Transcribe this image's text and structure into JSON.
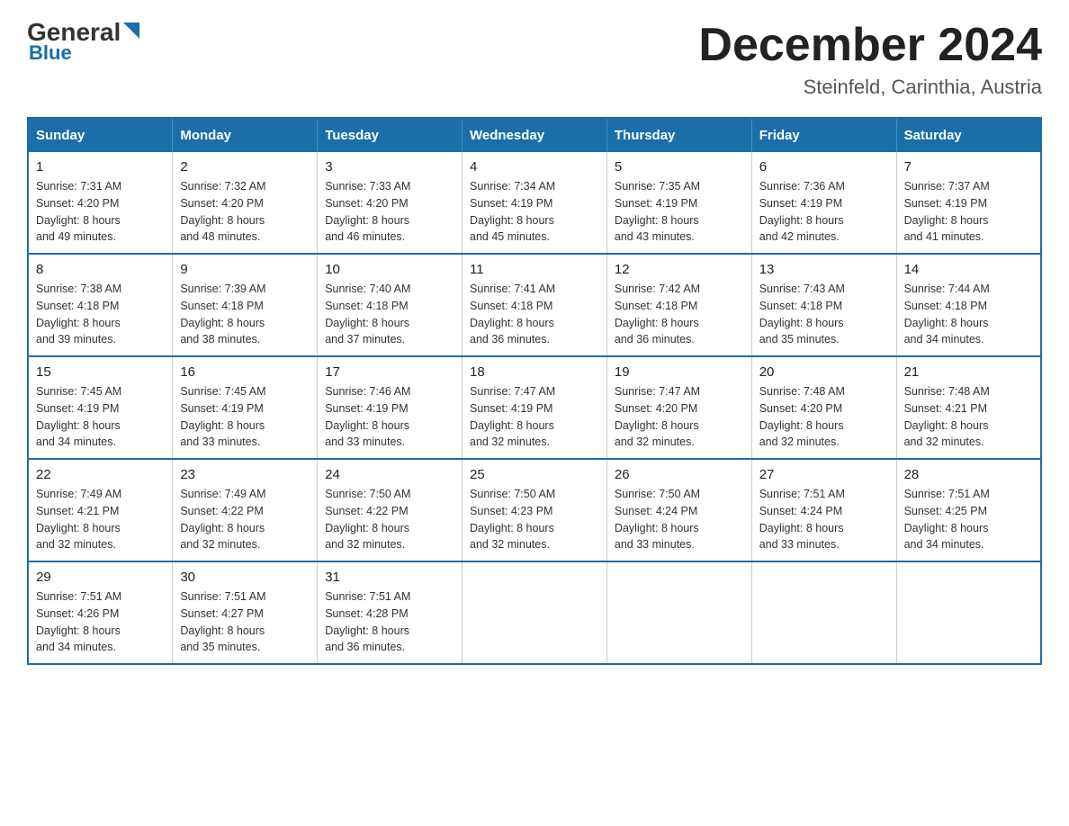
{
  "header": {
    "logo_general": "General",
    "logo_blue": "Blue",
    "month_year": "December 2024",
    "location": "Steinfeld, Carinthia, Austria"
  },
  "days_of_week": [
    "Sunday",
    "Monday",
    "Tuesday",
    "Wednesday",
    "Thursday",
    "Friday",
    "Saturday"
  ],
  "weeks": [
    [
      {
        "day": "1",
        "sunrise": "7:31 AM",
        "sunset": "4:20 PM",
        "daylight": "8 hours and 49 minutes."
      },
      {
        "day": "2",
        "sunrise": "7:32 AM",
        "sunset": "4:20 PM",
        "daylight": "8 hours and 48 minutes."
      },
      {
        "day": "3",
        "sunrise": "7:33 AM",
        "sunset": "4:20 PM",
        "daylight": "8 hours and 46 minutes."
      },
      {
        "day": "4",
        "sunrise": "7:34 AM",
        "sunset": "4:19 PM",
        "daylight": "8 hours and 45 minutes."
      },
      {
        "day": "5",
        "sunrise": "7:35 AM",
        "sunset": "4:19 PM",
        "daylight": "8 hours and 43 minutes."
      },
      {
        "day": "6",
        "sunrise": "7:36 AM",
        "sunset": "4:19 PM",
        "daylight": "8 hours and 42 minutes."
      },
      {
        "day": "7",
        "sunrise": "7:37 AM",
        "sunset": "4:19 PM",
        "daylight": "8 hours and 41 minutes."
      }
    ],
    [
      {
        "day": "8",
        "sunrise": "7:38 AM",
        "sunset": "4:18 PM",
        "daylight": "8 hours and 39 minutes."
      },
      {
        "day": "9",
        "sunrise": "7:39 AM",
        "sunset": "4:18 PM",
        "daylight": "8 hours and 38 minutes."
      },
      {
        "day": "10",
        "sunrise": "7:40 AM",
        "sunset": "4:18 PM",
        "daylight": "8 hours and 37 minutes."
      },
      {
        "day": "11",
        "sunrise": "7:41 AM",
        "sunset": "4:18 PM",
        "daylight": "8 hours and 36 minutes."
      },
      {
        "day": "12",
        "sunrise": "7:42 AM",
        "sunset": "4:18 PM",
        "daylight": "8 hours and 36 minutes."
      },
      {
        "day": "13",
        "sunrise": "7:43 AM",
        "sunset": "4:18 PM",
        "daylight": "8 hours and 35 minutes."
      },
      {
        "day": "14",
        "sunrise": "7:44 AM",
        "sunset": "4:18 PM",
        "daylight": "8 hours and 34 minutes."
      }
    ],
    [
      {
        "day": "15",
        "sunrise": "7:45 AM",
        "sunset": "4:19 PM",
        "daylight": "8 hours and 34 minutes."
      },
      {
        "day": "16",
        "sunrise": "7:45 AM",
        "sunset": "4:19 PM",
        "daylight": "8 hours and 33 minutes."
      },
      {
        "day": "17",
        "sunrise": "7:46 AM",
        "sunset": "4:19 PM",
        "daylight": "8 hours and 33 minutes."
      },
      {
        "day": "18",
        "sunrise": "7:47 AM",
        "sunset": "4:19 PM",
        "daylight": "8 hours and 32 minutes."
      },
      {
        "day": "19",
        "sunrise": "7:47 AM",
        "sunset": "4:20 PM",
        "daylight": "8 hours and 32 minutes."
      },
      {
        "day": "20",
        "sunrise": "7:48 AM",
        "sunset": "4:20 PM",
        "daylight": "8 hours and 32 minutes."
      },
      {
        "day": "21",
        "sunrise": "7:48 AM",
        "sunset": "4:21 PM",
        "daylight": "8 hours and 32 minutes."
      }
    ],
    [
      {
        "day": "22",
        "sunrise": "7:49 AM",
        "sunset": "4:21 PM",
        "daylight": "8 hours and 32 minutes."
      },
      {
        "day": "23",
        "sunrise": "7:49 AM",
        "sunset": "4:22 PM",
        "daylight": "8 hours and 32 minutes."
      },
      {
        "day": "24",
        "sunrise": "7:50 AM",
        "sunset": "4:22 PM",
        "daylight": "8 hours and 32 minutes."
      },
      {
        "day": "25",
        "sunrise": "7:50 AM",
        "sunset": "4:23 PM",
        "daylight": "8 hours and 32 minutes."
      },
      {
        "day": "26",
        "sunrise": "7:50 AM",
        "sunset": "4:24 PM",
        "daylight": "8 hours and 33 minutes."
      },
      {
        "day": "27",
        "sunrise": "7:51 AM",
        "sunset": "4:24 PM",
        "daylight": "8 hours and 33 minutes."
      },
      {
        "day": "28",
        "sunrise": "7:51 AM",
        "sunset": "4:25 PM",
        "daylight": "8 hours and 34 minutes."
      }
    ],
    [
      {
        "day": "29",
        "sunrise": "7:51 AM",
        "sunset": "4:26 PM",
        "daylight": "8 hours and 34 minutes."
      },
      {
        "day": "30",
        "sunrise": "7:51 AM",
        "sunset": "4:27 PM",
        "daylight": "8 hours and 35 minutes."
      },
      {
        "day": "31",
        "sunrise": "7:51 AM",
        "sunset": "4:28 PM",
        "daylight": "8 hours and 36 minutes."
      },
      null,
      null,
      null,
      null
    ]
  ],
  "labels": {
    "sunrise": "Sunrise:",
    "sunset": "Sunset:",
    "daylight": "Daylight:"
  },
  "colors": {
    "header_bg": "#1a6fa8",
    "border": "#1a6fa8",
    "text_dark": "#222222",
    "text_body": "#333333"
  }
}
